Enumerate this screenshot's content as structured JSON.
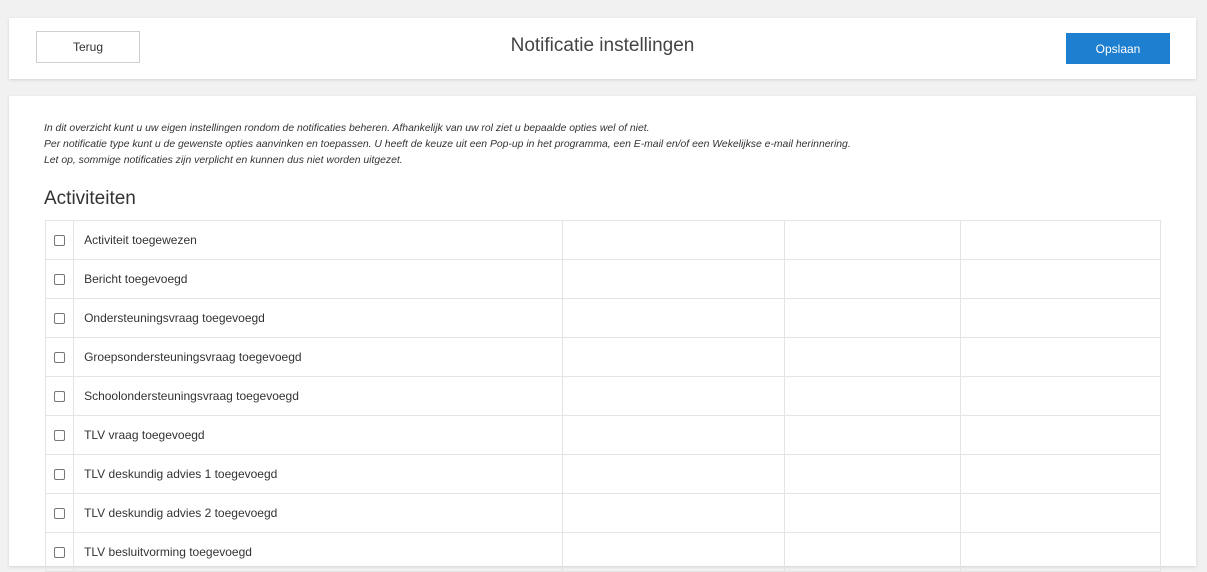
{
  "header": {
    "back_label": "Terug",
    "title": "Notificatie instellingen",
    "save_label": "Opslaan"
  },
  "intro": {
    "lines": [
      "In dit overzicht kunt u uw eigen instellingen rondom de notificaties beheren. Afhankelijk van uw rol ziet u bepaalde opties wel of niet.",
      "Per notificatie type kunt u de gewenste opties aanvinken en toepassen. U heeft de keuze uit een Pop-up in het programma, een E-mail en/of een Wekelijkse e-mail herinnering.",
      "Let op, sommige notificaties zijn verplicht en kunnen dus niet worden uitgezet."
    ]
  },
  "section": {
    "title": "Activiteiten",
    "rows": [
      {
        "label": "Activiteit toegewezen",
        "checked": false
      },
      {
        "label": "Bericht toegevoegd",
        "checked": false
      },
      {
        "label": "Ondersteuningsvraag toegevoegd",
        "checked": false
      },
      {
        "label": "Groepsondersteuningsvraag toegevoegd",
        "checked": false
      },
      {
        "label": "Schoolondersteuningsvraag toegevoegd",
        "checked": false
      },
      {
        "label": "TLV vraag toegevoegd",
        "checked": false
      },
      {
        "label": "TLV deskundig advies 1 toegevoegd",
        "checked": false
      },
      {
        "label": "TLV deskundig advies 2 toegevoegd",
        "checked": false
      },
      {
        "label": "TLV besluitvorming toegevoegd",
        "checked": false
      }
    ]
  },
  "colors": {
    "accent": "#1e7fd0",
    "background": "#f1f1f1"
  }
}
